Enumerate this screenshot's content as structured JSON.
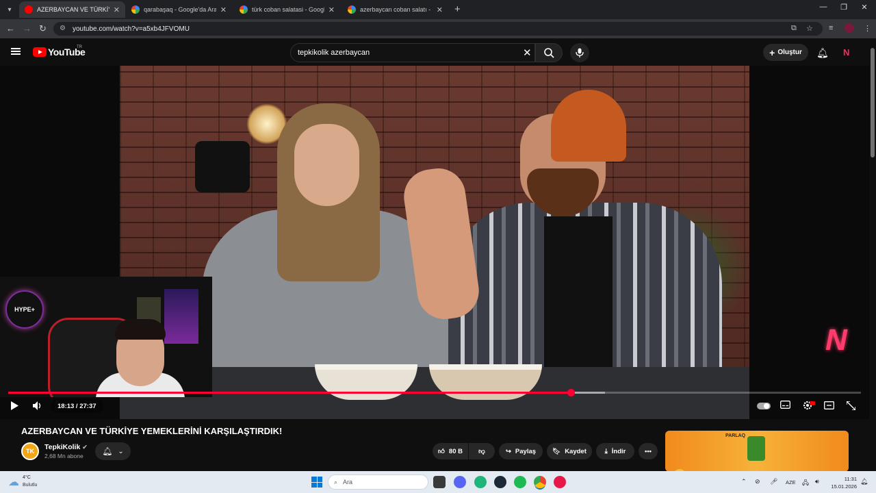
{
  "browser": {
    "tabs": [
      {
        "title": "AZERBAYCAN VE TÜRKİYE YEMEKLERİNİ",
        "active": true,
        "favicon": "youtube-icon"
      },
      {
        "title": "qarabaşaq - Google'da Ara",
        "active": false,
        "favicon": "google-icon"
      },
      {
        "title": "türk coban salatasi - Google'da Ara",
        "active": false,
        "favicon": "google-icon"
      },
      {
        "title": "azerbaycan coban salatı - Google'da Ara",
        "active": false,
        "favicon": "google-icon"
      }
    ],
    "url": "youtube.com/watch?v=a5xb4JFVOMU"
  },
  "youtube": {
    "logo_text": "YouTube",
    "region": "TR",
    "search_value": "tepkikolik azerbaycan",
    "create_label": "Oluştur"
  },
  "player": {
    "time_current": "18:13",
    "time_total": "27:37",
    "time_display": "18:13 / 27:37",
    "played_fraction": 0.66,
    "buffered_fraction": 0.7,
    "overlay_badge": "HYPE+"
  },
  "video": {
    "title": "AZERBAYCAN VE TÜRKİYE YEMEKLERİNİ KARŞILAŞTIRDIK!",
    "channel_name": "TepkiKolik",
    "channel_initials": "TK",
    "subscribers": "2,68 Mn abone",
    "like_count": "80 B",
    "share_label": "Paylaş",
    "save_label": "Kaydet",
    "download_label": "İndir"
  },
  "ad": {
    "brand": "PARLAQ"
  },
  "taskbar": {
    "temperature": "4°C",
    "condition": "Bulutlu",
    "search_placeholder": "Ara",
    "language": "AZE",
    "time": "11:31",
    "date": "15.01.2026"
  },
  "colors": {
    "youtube_red": "#ff0000",
    "progress_red": "#ff0033",
    "background": "#0f0f0f"
  }
}
